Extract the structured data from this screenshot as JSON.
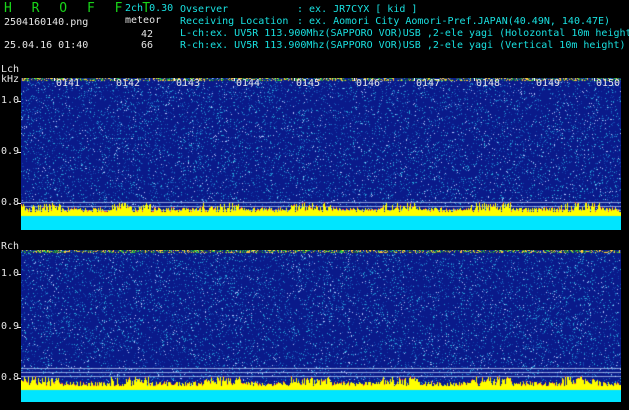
{
  "header": {
    "app_title": "H R O F F T",
    "mode": "2ch 0.30",
    "filename": "2504160140.png",
    "meteor_label": "meteor",
    "datetime": "25.04.16 01:40",
    "count_l": "42",
    "count_r": "66",
    "observer_label": "Ovserver",
    "observer_value": ": ex. JR7CYX [ kid ]",
    "location_label": "Receiving Location",
    "location_value": ": ex. Aomori City Aomori-Pref.JAPAN(40.49N, 140.47E)",
    "lch_info": "L-ch:ex. UV5R 113.900Mhz(SAPPORO VOR)USB ,2-ele yagi (Holozontal 10m height)",
    "rch_info": "R-ch:ex. UV5R 113.900Mhz(SAPPORO VOR)USB ,2-ele yagi (Vertical 10m height)"
  },
  "panels": {
    "lch": {
      "label": "Lch",
      "unit": "kHz"
    },
    "rch": {
      "label": "Rch"
    }
  },
  "y_ticks": [
    "1.0",
    "0.9",
    "0.8"
  ],
  "time_ticks": [
    "0141",
    "0142",
    "0143",
    "0144",
    "0145",
    "0146",
    "0147",
    "0148",
    "0149",
    "0150"
  ],
  "colors": {
    "background": "#000000",
    "spectrogram_base": "#0a1a8a",
    "title_green": "#19d619",
    "text_cyan": "#19e0e0",
    "baseline_cyan": "#00e5ff",
    "noise_yellow": "#ffff00"
  }
}
